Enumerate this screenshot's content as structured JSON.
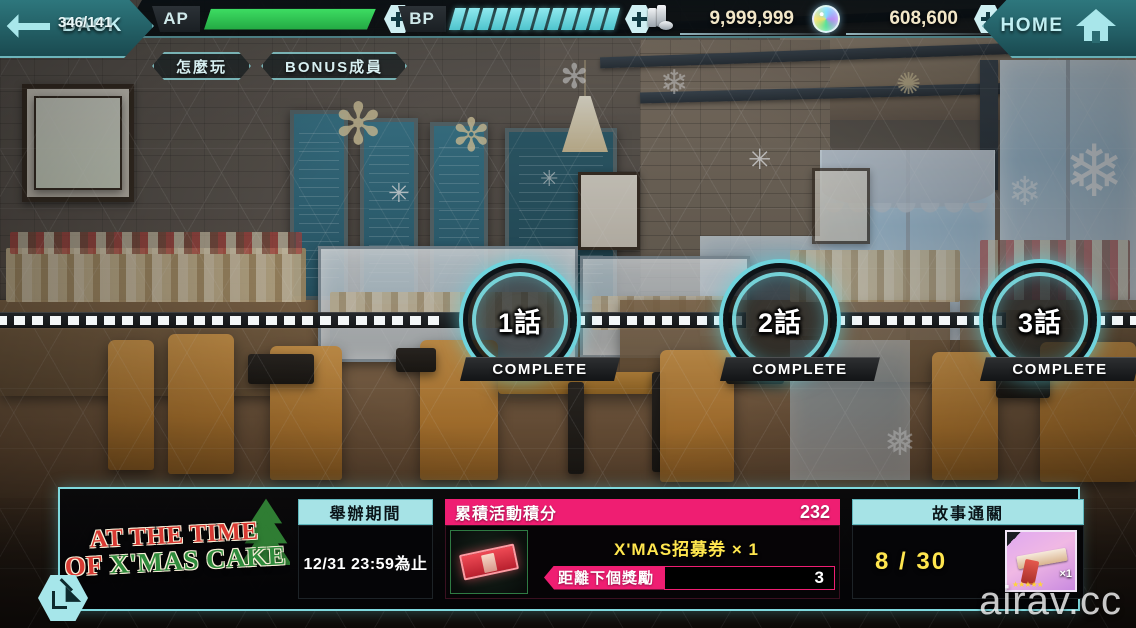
{
  "header": {
    "back_label": "BACK",
    "back_icon": "left-arrow-icon",
    "home_label": "HOME",
    "home_icon": "home-icon",
    "ap": {
      "label": "AP",
      "value": "346/141",
      "current": 346,
      "max": 141,
      "fill_color": "#3ddc62",
      "plus_icon": "plus-hex-icon"
    },
    "bp": {
      "label": "BP",
      "pips": 12,
      "pip_color": "#8fe9ef",
      "plus_icon": "plus-hex-icon"
    },
    "currency_gold": {
      "icon": "coin-stack-icon",
      "amount": "9,999,999"
    },
    "currency_gem": {
      "icon": "gem-orb-icon",
      "amount": "608,600",
      "plus_icon": "plus-hex-icon"
    }
  },
  "subtabs": [
    {
      "label": "怎麼玩"
    },
    {
      "label": "BONUS成員"
    }
  ],
  "map": {
    "nodes": [
      {
        "title": "1話",
        "status": "COMPLETE"
      },
      {
        "title": "2話",
        "status": "COMPLETE"
      },
      {
        "title": "3話",
        "status": "COMPLETE"
      }
    ]
  },
  "bottom": {
    "event_logo": {
      "line1": "AT THE TIME",
      "line2_of": "OF",
      "line2": "X'MAS CAKE",
      "tree_icon": "christmas-tree-icon"
    },
    "period": {
      "title": "舉辦期間",
      "value": "12/31 23:59為止"
    },
    "points": {
      "title": "累積活動積分",
      "value": "232",
      "reward_icon": "red-ticket-icon",
      "reward_text": "X'MAS招募券 × 1",
      "next_label": "距離下個獎勵",
      "next_value": "3",
      "header_color": "#ef1e72"
    },
    "story": {
      "title": "故事通關",
      "value": "8 / 30",
      "reward_icon": "pistol-card-icon",
      "reward_qty": "×1",
      "header_color": "#a6e3e6"
    }
  },
  "share_button": {
    "icon": "share-export-icon"
  },
  "watermark": {
    "text": "airav.cc"
  }
}
